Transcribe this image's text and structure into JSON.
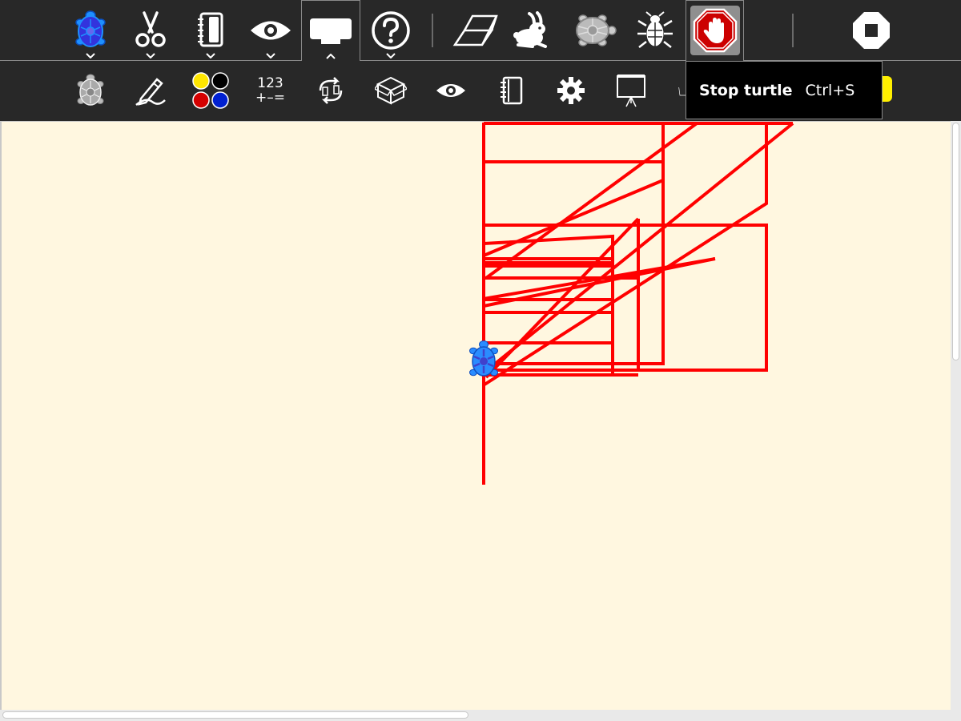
{
  "toolbar": {
    "activity_icon": "turtle-activity-icon",
    "edit_icon": "scissors-icon",
    "view_icon": "notebook-icon",
    "eye_icon": "eye-icon",
    "palette_icon": "palette-toolbar-icon",
    "help_icon": "help-icon",
    "clean_icon": "eraser-icon",
    "run_fast_icon": "rabbit-icon",
    "run_slow_icon": "turtle-icon",
    "debug_icon": "bug-icon",
    "stop_turtle_icon": "stop-hand-icon",
    "stop_icon": "stop-icon"
  },
  "subtoolbar": {
    "turtle_icon": "turtle-icon",
    "pen_icon": "pen-icon",
    "colors_icon": "color-dots-icon",
    "numbers_line1": "123",
    "numbers_line2": "+–=",
    "flow_icon": "refresh-icon",
    "box_icon": "box-icon",
    "sensors_icon": "eye-icon",
    "media_icon": "notebook-icon",
    "extras_icon": "gear-icon",
    "portfolio_icon": "presentation-icon"
  },
  "tooltip": {
    "label": "Stop turtle",
    "shortcut": "Ctrl+S"
  },
  "colors": {
    "toolbar_bg": "#282828",
    "canvas_bg": "#fff7e0",
    "pen": "#ff0000",
    "turtle_body": "#2a8cff",
    "turtle_shell": "#4040cc"
  }
}
